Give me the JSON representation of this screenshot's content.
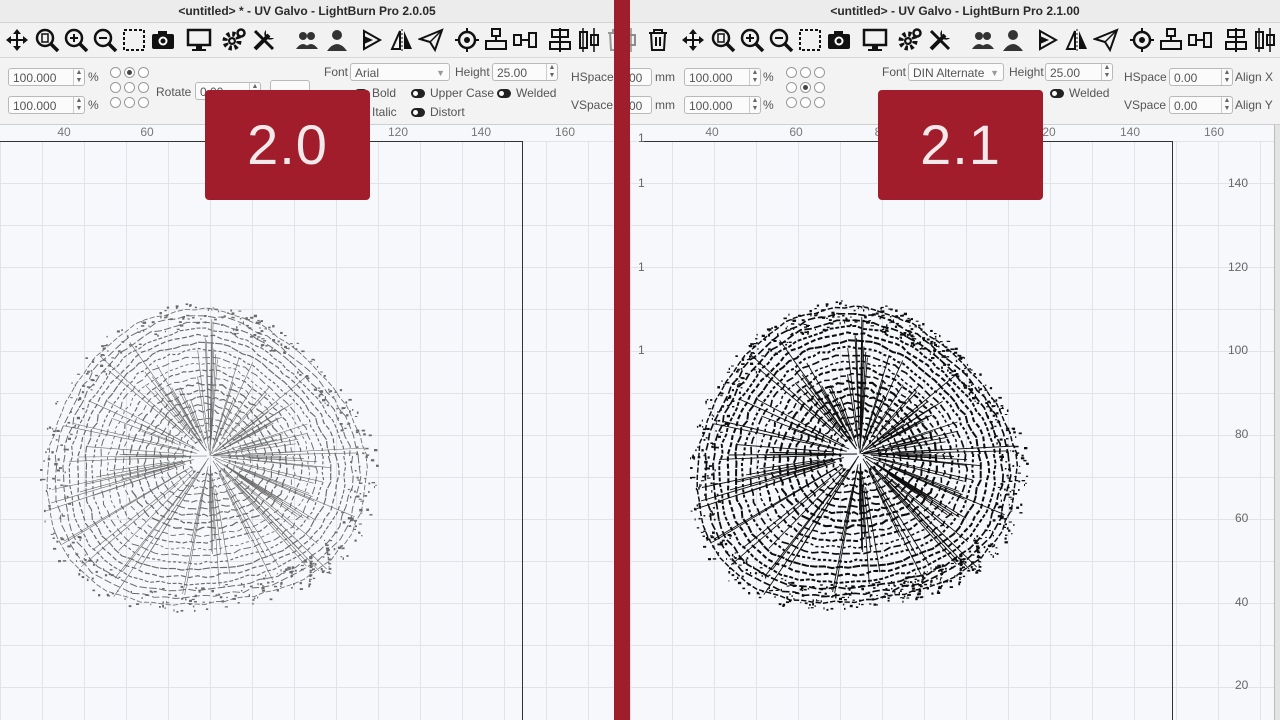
{
  "left": {
    "title": "<untitled> * - UV Galvo - LightBurn Pro 2.0.05",
    "version_badge": "2.0",
    "size_w": "100.000",
    "size_h": "100.000",
    "pct": "%",
    "rotate_label": "Rotate",
    "rotate_value": "0.00",
    "font_label": "Font",
    "font_value": "Arial",
    "height_label": "Height",
    "height_value": "25.00",
    "hspace_label": "HSpace",
    "vspace_label": "VSpace",
    "bold_label": "Bold",
    "italic_label": "Italic",
    "upper_case_label": "Upper Case",
    "distort_label": "Distort",
    "welded_label": "Welded",
    "ruler_top": [
      "40",
      "60",
      "120",
      "140",
      "160"
    ],
    "render_style": "light"
  },
  "right": {
    "title": "<untitled> - UV Galvo - LightBurn Pro 2.1.00",
    "version_badge": "2.1",
    "pos_x_partial": "00",
    "pos_y_partial": "00",
    "unit_mm": "mm",
    "size_w": "100.000",
    "size_h": "100.000",
    "pct": "%",
    "font_label": "Font",
    "font_value": "DIN Alternate",
    "height_label": "Height",
    "height_value": "25.00",
    "hspace_label": "HSpace",
    "hspace_value": "0.00",
    "vspace_label": "VSpace",
    "vspace_value": "0.00",
    "align_x_label": "Align X",
    "align_y_label": "Align Y",
    "welded_label": "Welded",
    "ruler_top": [
      "40",
      "60",
      "8",
      "20",
      "140",
      "160"
    ],
    "ruler_left": [
      "1",
      "1",
      "1",
      "1"
    ],
    "ruler_right": [
      "140",
      "120",
      "100",
      "80",
      "60",
      "40",
      "20"
    ],
    "render_style": "dark"
  },
  "colors": {
    "accent": "#a11d2c",
    "canvas": "#f7f8fb",
    "grid": "#e1e3e8"
  },
  "toolbar_icons": [
    "delete-icon",
    "move-icon",
    "zoom-page-icon",
    "zoom-in-icon",
    "zoom-out-icon",
    "zoom-selection-icon",
    "camera-icon",
    "monitor-icon",
    "settings-icon",
    "tools-icon",
    "users-icon",
    "user-icon",
    "path-icon",
    "mirror-icon",
    "send-icon",
    "target-icon",
    "align-icon",
    "distribute-icon",
    "align-center-icon",
    "distribute-v-icon"
  ]
}
